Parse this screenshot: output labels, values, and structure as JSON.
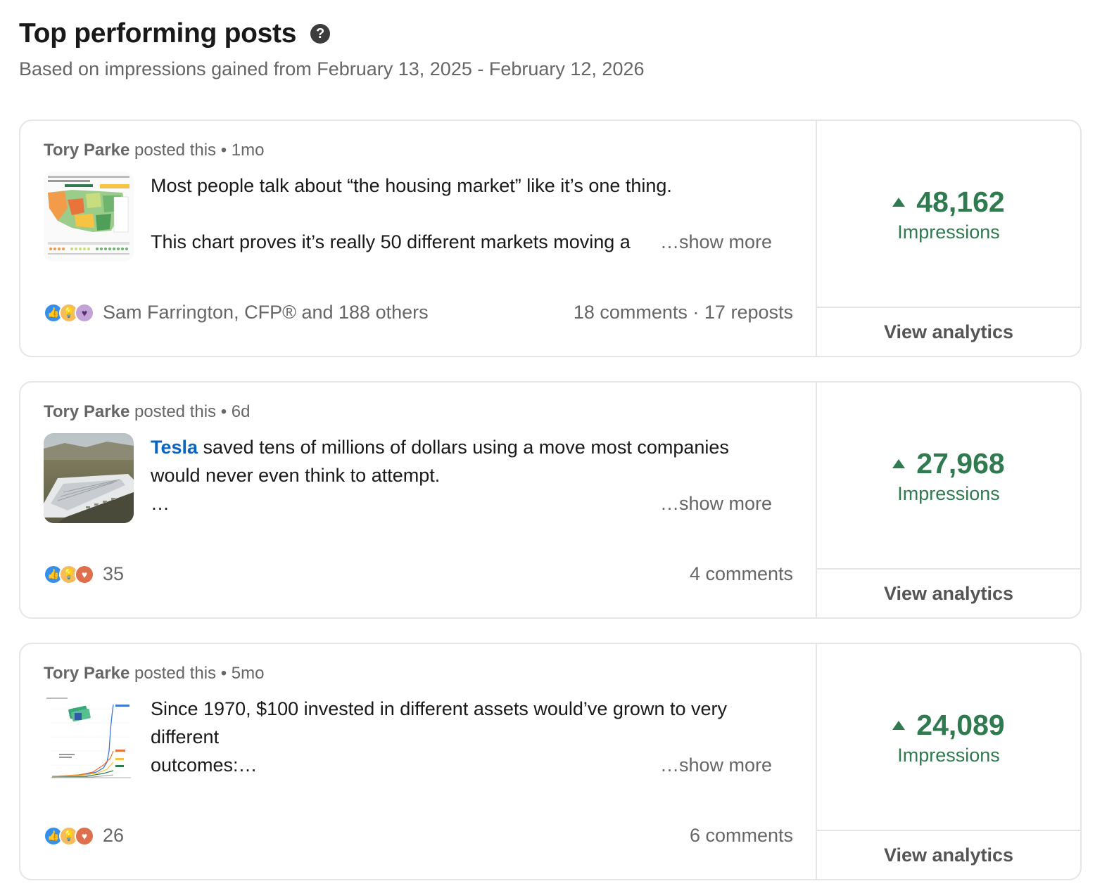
{
  "header": {
    "title": "Top performing posts",
    "help_icon": "?",
    "subtitle": "Based on impressions gained from February 13, 2025 - February 12, 2026"
  },
  "posts": [
    {
      "author": "Tory Parke",
      "posted_text": " posted this • 1mo",
      "thumbnail": "us-housing-map-chart",
      "lines": [
        "Most people talk about “the housing market” like it’s one thing.",
        "",
        "This chart proves it’s really 50 different markets moving a"
      ],
      "show_more": "…show more",
      "reactions_text": "Sam Farrington, CFP® and 188 others",
      "reaction_icons": [
        "like-icon",
        "insightful-icon",
        "support-icon"
      ],
      "engagement": "18 comments · 17 reposts",
      "impressions": "48,162",
      "impressions_label": "Impressions",
      "view_analytics": "View analytics"
    },
    {
      "author": "Tory Parke",
      "posted_text": " posted this • 6d",
      "thumbnail": "factory-aerial-photo",
      "mention": "Tesla",
      "lines": [
        " saved tens of millions of dollars using a move most companies",
        "would never even think to attempt.",
        "…"
      ],
      "show_more": "…show more",
      "reactions_text": "35",
      "reaction_icons": [
        "like-icon",
        "insightful-icon",
        "love-icon"
      ],
      "engagement": "4 comments",
      "impressions": "27,968",
      "impressions_label": "Impressions",
      "view_analytics": "View analytics"
    },
    {
      "author": "Tory Parke",
      "posted_text": " posted this • 5mo",
      "thumbnail": "asset-growth-chart",
      "lines": [
        "Since 1970, $100 invested in different assets would’ve grown to very",
        "different",
        "outcomes:…"
      ],
      "show_more": "…show more",
      "reactions_text": "26",
      "reaction_icons": [
        "like-icon",
        "insightful-icon",
        "love-icon"
      ],
      "engagement": "6 comments",
      "impressions": "24,089",
      "impressions_label": "Impressions",
      "view_analytics": "View analytics"
    }
  ],
  "colors": {
    "impressions_green": "#2f7b4f",
    "mention_blue": "#0a66c2",
    "muted_text": "#666666",
    "border": "#e6e6e6"
  }
}
